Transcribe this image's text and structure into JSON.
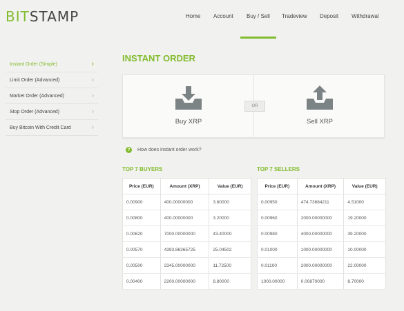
{
  "brand": {
    "prefix": "BIT",
    "suffix": "STAMP",
    "accent_color": "#82bc2e"
  },
  "nav": {
    "items": [
      {
        "label": "Home"
      },
      {
        "label": "Account"
      },
      {
        "label": "Buy / Sell",
        "active": true
      },
      {
        "label": "Tradeview"
      },
      {
        "label": "Deposit"
      },
      {
        "label": "Withdrawal"
      }
    ]
  },
  "sidebar": {
    "items": [
      {
        "label": "Instant Order (Simple)",
        "active": true
      },
      {
        "label": "Limit Order (Advanced)"
      },
      {
        "label": "Market Order (Advanced)"
      },
      {
        "label": "Stop Order (Advanced)"
      },
      {
        "label": "Buy Bitcoin With Credit Card"
      }
    ]
  },
  "main": {
    "title": "INSTANT ORDER",
    "buy_label": "Buy XRP",
    "sell_label": "Sell XRP",
    "or_label": "OR",
    "help_text": "How does instant order work?"
  },
  "buyers": {
    "title": "TOP 7 BUYERS",
    "columns": [
      "Price (EUR)",
      "Amount (XRP)",
      "Value (EUR)"
    ],
    "rows": [
      [
        "0.00900",
        "400.00000000",
        "3.60000"
      ],
      [
        "0.00800",
        "400.00000000",
        "3.20000"
      ],
      [
        "0.00620",
        "7000.00000000",
        "43.40000"
      ],
      [
        "0.00570",
        "4393.86365725",
        "25.04502"
      ],
      [
        "0.00500",
        "2345.00000000",
        "11.72500"
      ],
      [
        "0.00400",
        "2200.00000000",
        "8.80000"
      ]
    ]
  },
  "sellers": {
    "title": "TOP 7 SELLERS",
    "columns": [
      "Price (EUR)",
      "Amount (XRP)",
      "Value (EUR)"
    ],
    "rows": [
      [
        "0.00950",
        "474.73684211",
        "4.51000"
      ],
      [
        "0.00960",
        "2000.00000000",
        "19.20000"
      ],
      [
        "0.00980",
        "4000.00000000",
        "39.20000"
      ],
      [
        "0.01000",
        "1000.00000000",
        "10.00000"
      ],
      [
        "0.01100",
        "2000.00000000",
        "22.00000"
      ],
      [
        "1000.00000",
        "0.00870000",
        "8.70000"
      ]
    ]
  }
}
